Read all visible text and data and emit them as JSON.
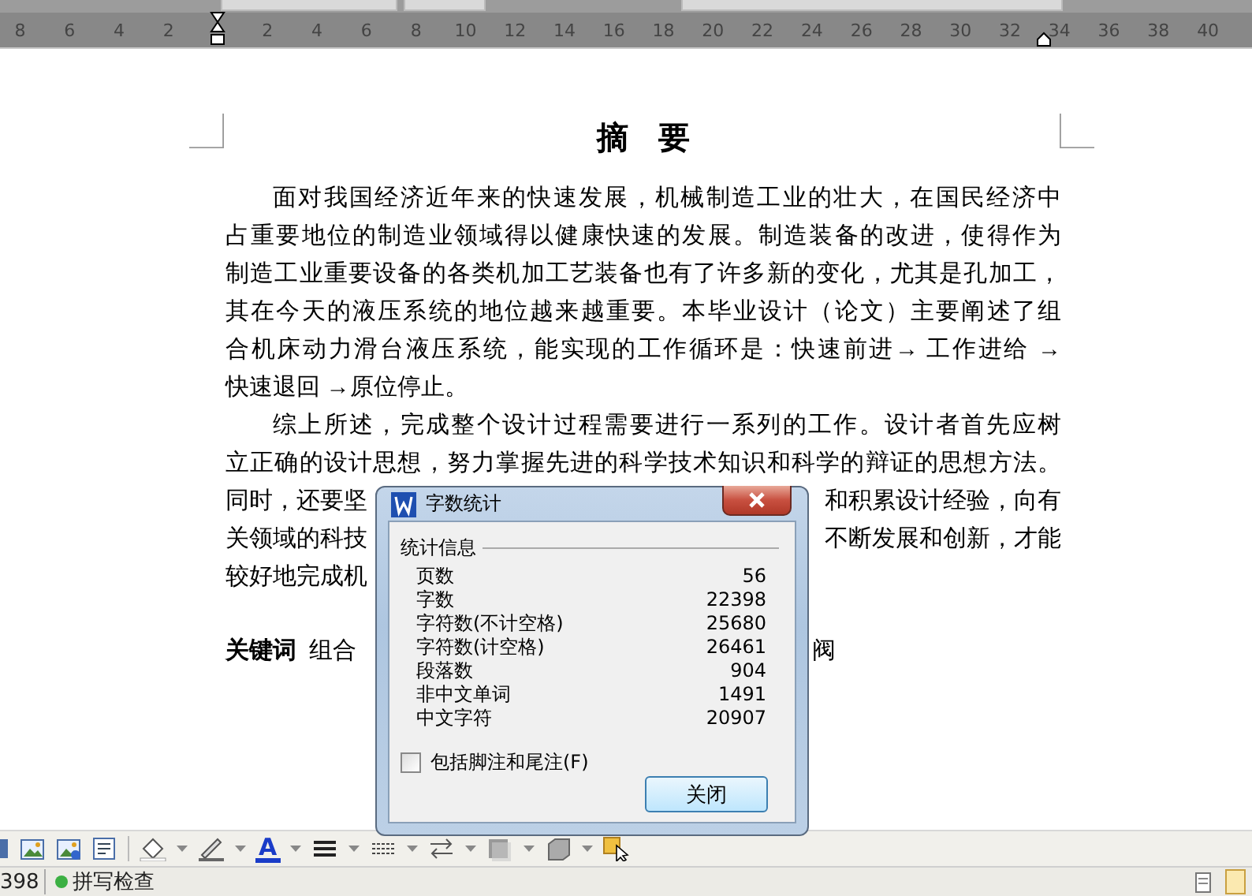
{
  "ruler": {
    "left_labels": [
      "8",
      "6",
      "4",
      "2"
    ],
    "labels": [
      "2",
      "4",
      "6",
      "8",
      "10",
      "12",
      "14",
      "16",
      "18",
      "20",
      "22",
      "24",
      "26",
      "28",
      "30",
      "32",
      "34",
      "36",
      "38",
      "40"
    ]
  },
  "document": {
    "title": "摘 要",
    "paragraph_lines": [
      "面对我国经济近年来的快速发展，机械制造工业的壮大，在国民经济中",
      "占重要地位的制造业领域得以健康快速的发展。制造装备的改进，使得作为",
      "制造工业重要设备的各类机加工艺装备也有了许多新的变化，尤其是孔加工，",
      "其在今天的液压系统的地位越来越重要。本毕业设计（论文）主要阐述了组",
      "合机床动力滑台液压系统，能实现的工作循环是：快速前进→ 工作进给 →",
      "快速退回 →原位停止。"
    ],
    "paragraph_2_lines": [
      {
        "left": "综上所述，完成整个设计过程需要进行一系列的工作。设计者首先应树"
      },
      {
        "left": "立正确的设计思想，努力掌握先进的科学技术知识和科学的辩证的思想方法。"
      },
      {
        "left": "同时，还要坚",
        "right": "和积累设计经验，向有"
      },
      {
        "left": "关领域的科技",
        "right": "不断发展和创新，才能"
      },
      {
        "left": "较好地完成机"
      }
    ],
    "keywords": {
      "label": "关键词",
      "left": "组合",
      "right": "阀"
    }
  },
  "dialog": {
    "title": "字数统计",
    "group": "统计信息",
    "stats": [
      {
        "label": "页数",
        "value": "56"
      },
      {
        "label": "字数",
        "value": "22398"
      },
      {
        "label": "字符数(不计空格)",
        "value": "25680"
      },
      {
        "label": "字符数(计空格)",
        "value": "26461"
      },
      {
        "label": "段落数",
        "value": "904"
      },
      {
        "label": "非中文单词",
        "value": "1491"
      },
      {
        "label": "中文字符",
        "value": "20907"
      }
    ],
    "checkbox": {
      "label": "包括脚注和尾注(F)",
      "checked": false
    },
    "button": "关闭"
  },
  "toolbar": {
    "font_color_label": "A"
  },
  "status_bar": {
    "count": "398",
    "spell_check": "拼写检查"
  }
}
